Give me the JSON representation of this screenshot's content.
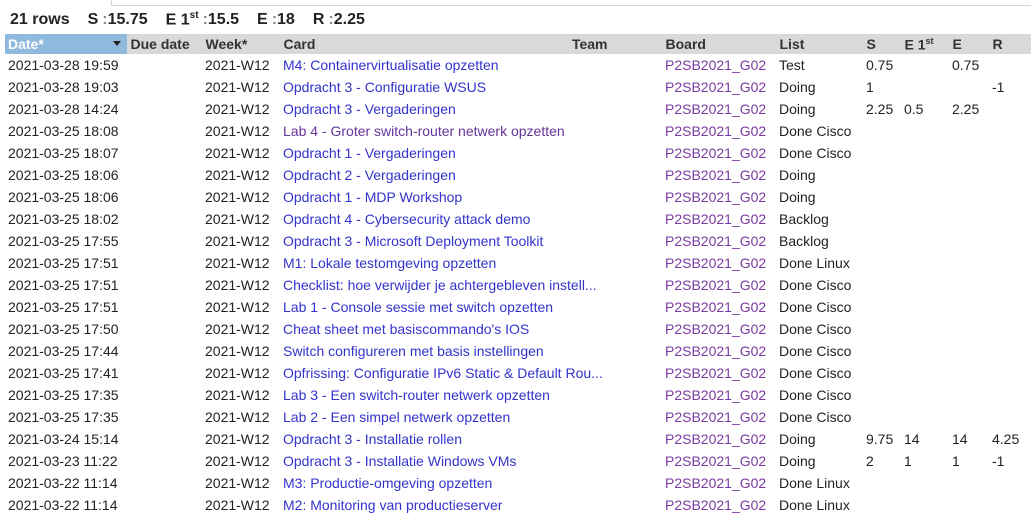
{
  "summary": {
    "rows": "21 rows",
    "s_label": "S",
    "s_value": "15.75",
    "e1_label": "E 1",
    "e1_sup": "st",
    "e1_value": "15.5",
    "e_label": "E",
    "e_value": "18",
    "r_label": "R",
    "r_value": "2.25"
  },
  "columns": {
    "date": "Date*",
    "due": "Due date",
    "week": "Week*",
    "card": "Card",
    "team": "Team",
    "board": "Board",
    "list": "List",
    "s": "S",
    "e1": "E 1",
    "e1_sup": "st",
    "e": "E",
    "r": "R"
  },
  "rows": [
    {
      "date": "2021-03-28 19:59",
      "due": "",
      "week": "2021-W12",
      "card": "M4: Containervirtualisatie opzetten",
      "team": "",
      "board": "P2SB2021_G02",
      "list": "Test",
      "s": "0.75",
      "e1": "",
      "e": "0.75",
      "r": ""
    },
    {
      "date": "2021-03-28 19:03",
      "due": "",
      "week": "2021-W12",
      "card": "Opdracht 3 - Configuratie WSUS",
      "team": "",
      "board": "P2SB2021_G02",
      "list": "Doing",
      "s": "1",
      "e1": "",
      "e": "",
      "r": "-1"
    },
    {
      "date": "2021-03-28 14:24",
      "due": "",
      "week": "2021-W12",
      "card": "Opdracht 3 - Vergaderingen",
      "team": "",
      "board": "P2SB2021_G02",
      "list": "Doing",
      "s": "2.25",
      "e1": "0.5",
      "e": "2.25",
      "r": ""
    },
    {
      "date": "2021-03-25 18:08",
      "due": "",
      "week": "2021-W12",
      "card": "Lab 4 - Groter switch-router netwerk opzetten",
      "team": "",
      "board": "P2SB2021_G02",
      "list": "Done Cisco",
      "s": "",
      "e1": "",
      "e": "",
      "r": ""
    },
    {
      "date": "2021-03-25 18:07",
      "due": "",
      "week": "2021-W12",
      "card": "Opdracht 1 - Vergaderingen",
      "team": "",
      "board": "P2SB2021_G02",
      "list": "Done Cisco",
      "s": "",
      "e1": "",
      "e": "",
      "r": ""
    },
    {
      "date": "2021-03-25 18:06",
      "due": "",
      "week": "2021-W12",
      "card": "Opdracht 2 - Vergaderingen",
      "team": "",
      "board": "P2SB2021_G02",
      "list": "Doing",
      "s": "",
      "e1": "",
      "e": "",
      "r": ""
    },
    {
      "date": "2021-03-25 18:06",
      "due": "",
      "week": "2021-W12",
      "card": "Opdracht 1 - MDP Workshop",
      "team": "",
      "board": "P2SB2021_G02",
      "list": "Doing",
      "s": "",
      "e1": "",
      "e": "",
      "r": ""
    },
    {
      "date": "2021-03-25 18:02",
      "due": "",
      "week": "2021-W12",
      "card": "Opdracht 4 - Cybersecurity attack demo",
      "team": "",
      "board": "P2SB2021_G02",
      "list": "Backlog",
      "s": "",
      "e1": "",
      "e": "",
      "r": ""
    },
    {
      "date": "2021-03-25 17:55",
      "due": "",
      "week": "2021-W12",
      "card": "Opdracht 3 - Microsoft Deployment Toolkit",
      "team": "",
      "board": "P2SB2021_G02",
      "list": "Backlog",
      "s": "",
      "e1": "",
      "e": "",
      "r": ""
    },
    {
      "date": "2021-03-25 17:51",
      "due": "",
      "week": "2021-W12",
      "card": "M1: Lokale testomgeving opzetten",
      "team": "",
      "board": "P2SB2021_G02",
      "list": "Done Linux",
      "s": "",
      "e1": "",
      "e": "",
      "r": ""
    },
    {
      "date": "2021-03-25 17:51",
      "due": "",
      "week": "2021-W12",
      "card": "Checklist: hoe verwijder je achtergebleven instell...",
      "team": "",
      "board": "P2SB2021_G02",
      "list": "Done Cisco",
      "s": "",
      "e1": "",
      "e": "",
      "r": ""
    },
    {
      "date": "2021-03-25 17:51",
      "due": "",
      "week": "2021-W12",
      "card": "Lab 1 - Console sessie met switch opzetten",
      "team": "",
      "board": "P2SB2021_G02",
      "list": "Done Cisco",
      "s": "",
      "e1": "",
      "e": "",
      "r": ""
    },
    {
      "date": "2021-03-25 17:50",
      "due": "",
      "week": "2021-W12",
      "card": "Cheat sheet met basiscommando's IOS",
      "team": "",
      "board": "P2SB2021_G02",
      "list": "Done Cisco",
      "s": "",
      "e1": "",
      "e": "",
      "r": ""
    },
    {
      "date": "2021-03-25 17:44",
      "due": "",
      "week": "2021-W12",
      "card": "Switch configureren met basis instellingen",
      "team": "",
      "board": "P2SB2021_G02",
      "list": "Done Cisco",
      "s": "",
      "e1": "",
      "e": "",
      "r": ""
    },
    {
      "date": "2021-03-25 17:41",
      "due": "",
      "week": "2021-W12",
      "card": "Opfrissing: Configuratie IPv6 Static & Default Rou...",
      "team": "",
      "board": "P2SB2021_G02",
      "list": "Done Cisco",
      "s": "",
      "e1": "",
      "e": "",
      "r": ""
    },
    {
      "date": "2021-03-25 17:35",
      "due": "",
      "week": "2021-W12",
      "card": "Lab 3 - Een switch-router netwerk opzetten",
      "team": "",
      "board": "P2SB2021_G02",
      "list": "Done Cisco",
      "s": "",
      "e1": "",
      "e": "",
      "r": ""
    },
    {
      "date": "2021-03-25 17:35",
      "due": "",
      "week": "2021-W12",
      "card": "Lab 2 - Een simpel netwerk opzetten",
      "team": "",
      "board": "P2SB2021_G02",
      "list": "Done Cisco",
      "s": "",
      "e1": "",
      "e": "",
      "r": ""
    },
    {
      "date": "2021-03-24 15:14",
      "due": "",
      "week": "2021-W12",
      "card": "Opdracht 3 - Installatie rollen",
      "team": "",
      "board": "P2SB2021_G02",
      "list": "Doing",
      "s": "9.75",
      "e1": "14",
      "e": "14",
      "r": "4.25"
    },
    {
      "date": "2021-03-23 11:22",
      "due": "",
      "week": "2021-W12",
      "card": "Opdracht 3 - Installatie Windows VMs",
      "team": "",
      "board": "P2SB2021_G02",
      "list": "Doing",
      "s": "2",
      "e1": "1",
      "e": "1",
      "r": "-1"
    },
    {
      "date": "2021-03-22 11:14",
      "due": "",
      "week": "2021-W12",
      "card": "M3: Productie-omgeving opzetten",
      "team": "",
      "board": "P2SB2021_G02",
      "list": "Done Linux",
      "s": "",
      "e1": "",
      "e": "",
      "r": ""
    },
    {
      "date": "2021-03-22 11:14",
      "due": "",
      "week": "2021-W12",
      "card": "M2: Monitoring van productieserver",
      "team": "",
      "board": "P2SB2021_G02",
      "list": "Done Linux",
      "s": "",
      "e1": "",
      "e": "",
      "r": ""
    }
  ],
  "colors": {
    "link": "#3333cc",
    "visited_link": "#663399",
    "board": "#7a3ba0",
    "header_bg": "#d9d9d9",
    "sorted_header_bg": "#8fb9dd"
  }
}
